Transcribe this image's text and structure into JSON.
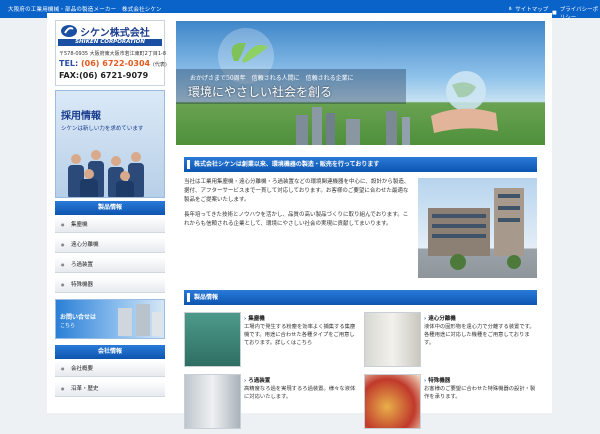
{
  "topbar": {
    "tagline": "大阪府の工業用機械・部品の製造メーカー　株式会社シケン",
    "links": [
      {
        "label": "サイトマップ",
        "icon": "sitemap-icon"
      },
      {
        "label": "プライバシーポリシー",
        "icon": "lock-icon"
      }
    ]
  },
  "logo": {
    "company": "シケン株式会社",
    "corp_en": "SHIKEN CORPORATION",
    "address": "〒578-0935 大阪府東大阪市若江東町2丁目1-8",
    "tel_label": "TEL:",
    "tel": "(06) 6722-0304",
    "tel_note": "(代表)",
    "fax": "FAX:(06) 6721-9079"
  },
  "recruit": {
    "title": "採用情報",
    "subtitle": "シケンは新しい力を求めています"
  },
  "sidebar": {
    "products_heading": "製品情報",
    "products": [
      "集塵機",
      "遠心分離機",
      "ろ過装置",
      "特殊機器"
    ],
    "contact_title": "お問い合せは",
    "contact_sub": "こちら",
    "company_heading": "会社情報",
    "company_items": [
      "会社概要",
      "沿革・歴史"
    ]
  },
  "hero": {
    "catch_small": "おかげさまで50周年　信頼される人間に　信頼される企業に",
    "catch_large": "環境にやさしい社会を創る"
  },
  "intro": {
    "heading": "株式会社シケンは創業以来、環境機器の製造・販売を行っております",
    "paragraphs": [
      "当社は工業用集塵機・遠心分離機・ろ過装置などの環境関連機器を中心に、設計から製造、据付、アフターサービスまで一貫して対応しております。お客様のご要望に合わせた最適な製品をご提案いたします。",
      "長年培ってきた技術とノウハウを活かし、品質の高い製品づくりに取り組んでおります。これからも信頼される企業として、環境にやさしい社会の実現に貢献してまいります。"
    ]
  },
  "products": {
    "heading": "製品情報",
    "items": [
      {
        "name": "集塵機",
        "desc": "工場内で発生する粉塵を効率よく捕集する集塵機です。用途に合わせた各種タイプをご用意しております。詳しくはこちら"
      },
      {
        "name": "遠心分離機",
        "desc": "液体中の固形物を遠心力で分離する装置です。各種用途に対応した機種をご用意しております。"
      },
      {
        "name": "ろ過装置",
        "desc": "高精度なろ過を実現するろ過装置。様々な液体に対応いたします。"
      },
      {
        "name": "特殊機器",
        "desc": "お客様のご要望に合わせた特殊機器の設計・製作を承ります。"
      }
    ]
  },
  "colors": {
    "brand": "#0a63c9",
    "accent": "#e45a1f"
  }
}
